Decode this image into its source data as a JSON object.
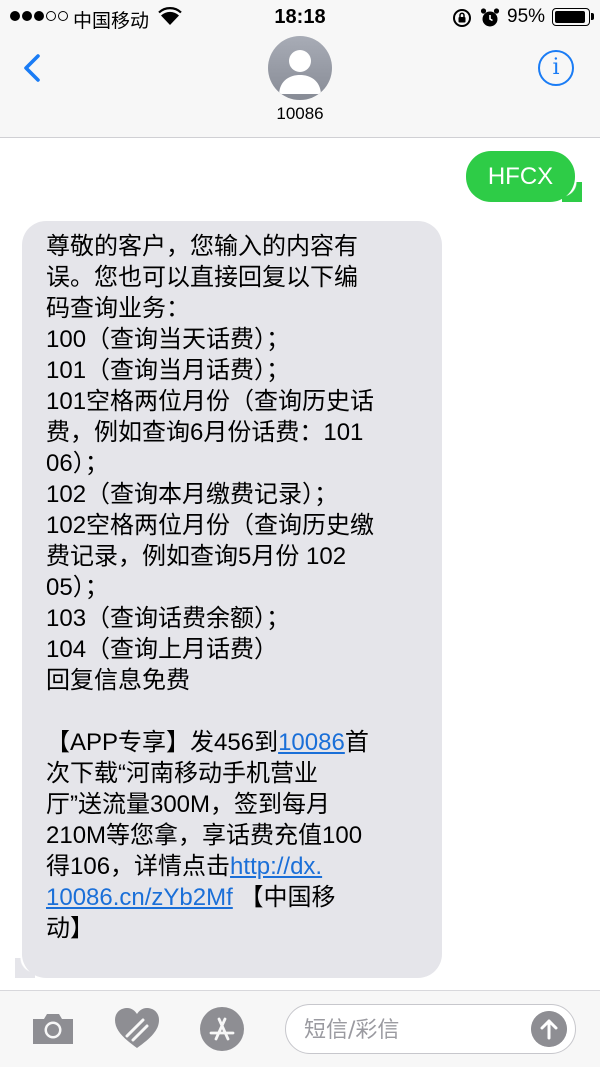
{
  "status_bar": {
    "carrier": "中国移动",
    "time": "18:18",
    "battery_percent_text": "95%",
    "battery_level": 0.95
  },
  "header": {
    "contact": "10086",
    "info_label": "i"
  },
  "messages": {
    "outgoing": [
      {
        "text": "HFCX"
      }
    ],
    "incoming": {
      "lines": [
        "尊敬的客户，您输入的内容有",
        "误。您也可以直接回复以下编",
        "码查询业务：",
        "100（查询当天话费）；",
        "101（查询当月话费）；",
        "101空格两位月份（查询历史话",
        "费，例如查询6月份话费：101",
        "06）；",
        "102（查询本月缴费记录）；",
        "102空格两位月份（查询历史缴",
        "费记录，例如查询5月份 102",
        "05）；",
        "103（查询话费余额）；",
        "104（查询上月话费）",
        "回复信息免费"
      ],
      "promo": {
        "line1_prefix": "【APP专享】发456到",
        "line1_link": "10086",
        "line1_suffix": "首",
        "line2": "次下载“河南移动手机营业",
        "line3": "厅”送流量300M，签到每月",
        "line4": "210M等您拿，享话费充值100",
        "line5_prefix": "得106，详情点击",
        "line5_link": "http://dx.",
        "line6_link": "10086.cn/zYb2Mf",
        "line6_suffix": " 【中国移",
        "line7": "动】"
      }
    }
  },
  "input_bar": {
    "placeholder": "短信/彩信",
    "icons": [
      "camera-icon",
      "digital-touch-icon",
      "app-store-icon",
      "send-arrow-icon"
    ]
  },
  "colors": {
    "ios_blue": "#1a7cf5",
    "sms_green": "#2ecc47",
    "bubble_gray": "#e5e5ea",
    "link_blue": "#1a6fd8"
  }
}
